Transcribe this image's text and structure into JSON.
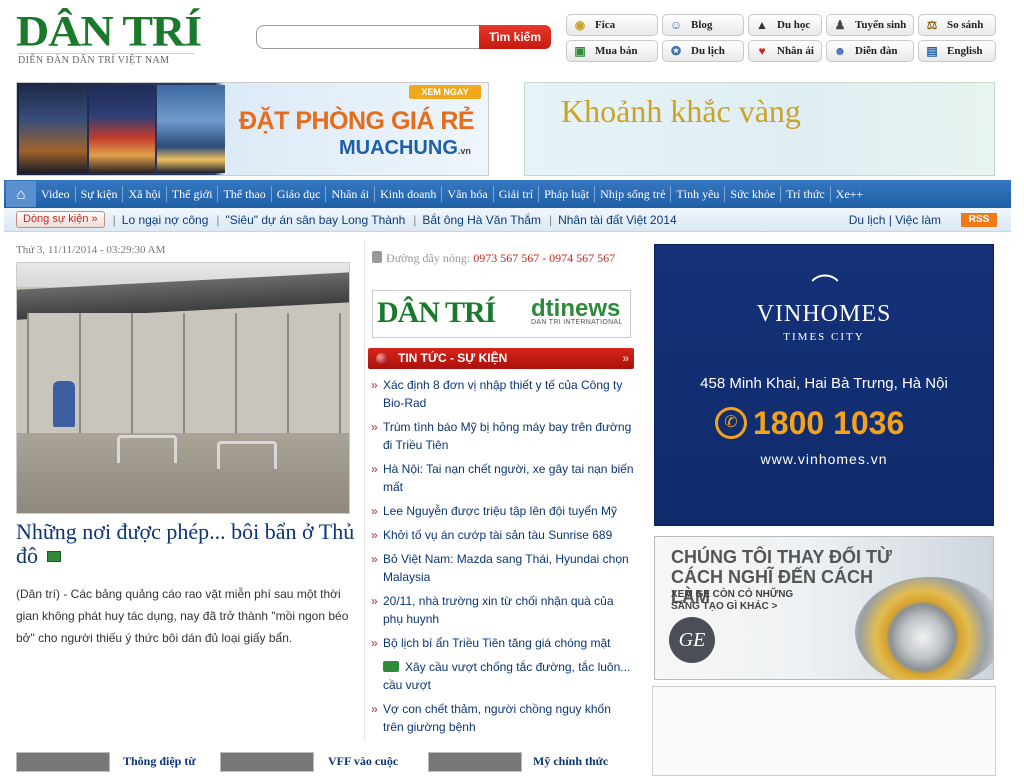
{
  "header": {
    "logo": "DÂN TRÍ",
    "tagline": "DIỄN ĐÀN DÂN TRÍ VIỆT NAM",
    "search": {
      "placeholder": "",
      "button": "Tìm kiếm"
    },
    "quick_links": [
      {
        "label": "Fica",
        "icon": "coins-icon"
      },
      {
        "label": "Blog",
        "icon": "users-icon"
      },
      {
        "label": "Du học",
        "icon": "graduation-cap-icon"
      },
      {
        "label": "Tuyển sinh",
        "icon": "student-icon"
      },
      {
        "label": "So sánh",
        "icon": "scales-icon"
      },
      {
        "label": "Mua bán",
        "icon": "shopping-icon"
      },
      {
        "label": "Du lịch",
        "icon": "compass-icon"
      },
      {
        "label": "Nhân ái",
        "icon": "heart-icon"
      },
      {
        "label": "Diễn đàn",
        "icon": "forum-icon"
      },
      {
        "label": "English",
        "icon": "book-icon"
      }
    ]
  },
  "banners": {
    "left": {
      "cta": "XEM NGAY",
      "headline": "ĐẶT PHÒNG GIÁ RẺ",
      "brand": "MUACHUNG",
      "brand_suffix": ".vn"
    },
    "right": {
      "headline": "Khoảnh khắc vàng"
    }
  },
  "nav": {
    "home_icon": "home-icon",
    "items": [
      "Video",
      "Sự kiện",
      "Xã hội",
      "Thế giới",
      "Thể thao",
      "Giáo dục",
      "Nhân ái",
      "Kinh doanh",
      "Văn hóa",
      "Giải trí",
      "Pháp luật",
      "Nhịp sống trẻ",
      "Tình yêu",
      "Sức khỏe",
      "Trí thức",
      "Xe++"
    ]
  },
  "subbar": {
    "label": "Dòng sự kiện »",
    "hot_topics": [
      "Lo ngại nợ công",
      "\"Siêu\" dự án sân bay Long Thành",
      "Bắt ông Hà Văn Thắm",
      "Nhân tài đất Việt 2014"
    ],
    "right_links": [
      "Du lịch",
      "Việc làm"
    ],
    "rss": "RSS"
  },
  "main": {
    "date": "Thứ 3, 11/11/2014 - 03:29:30 AM",
    "title": "Những nơi được phép... bôi bẩn ở Thủ đô",
    "summary": "(Dân trí) - Các bảng quảng cáo rao vặt miễn phí sau một thời gian không phát huy tác dụng, nay đã trở thành \"mồi ngon béo bở\" cho người thiếu ý thức bôi dán đủ loại giấy bẩn."
  },
  "thumbs": [
    {
      "text": "Thông điệp từ"
    },
    {
      "text": "VFF vào cuộc"
    },
    {
      "text": "Mỹ chính thức"
    }
  ],
  "middle": {
    "hotline_label": "Đường dây nóng:",
    "hotline_numbers": "0973 567 567 - 0974 567 567",
    "logo_dantri": "DÂN TRÍ",
    "logo_dti": "dtinews",
    "logo_dti_sub": "DAN TRI INTERNATIONAL",
    "section_title": "TIN TỨC - SỰ KIỆN",
    "news": [
      "Xác định 8 đơn vị nhập thiết y tế của Công ty Bio-Rad",
      "Trùm tình báo Mỹ bị hỏng máy bay trên đường đi Triều Tiên",
      "Hà Nội: Tai nạn chết người, xe gây tai nạn biến mất",
      "Lee Nguyễn được triệu tập lên đội tuyển Mỹ",
      "Khởi tố vụ án cướp tài sản tàu Sunrise 689",
      "Bỏ Việt Nam: Mazda sang Thái, Hyundai chọn Malaysia",
      "20/11, nhà trường xin từ chối nhận quà của phụ huynh",
      "Bộ lịch bí ẩn Triều Tiên tăng giá chóng mặt",
      "Xây cầu vượt chống tắc đường, tắc luôn... cầu vượt",
      "Vợ con chết thảm, người chồng nguy khốn trên giường bệnh"
    ]
  },
  "ads": {
    "vinhomes": {
      "brand": "VINHOMES",
      "sub": "TIMES CITY",
      "address": "458 Minh Khai, Hai Bà Trưng, Hà Nội",
      "phone": "1800 1036",
      "web": "www.vinhomes.vn"
    },
    "ge": {
      "headline": "CHÚNG TÔI THAY ĐỔI TỪ CÁCH NGHĨ ĐẾN CÁCH LÀM",
      "small1": "XEM GE CÒN CÓ NHỮNG",
      "small2": "SÁNG TẠO GÌ KHÁC >",
      "logo": "GE"
    }
  },
  "colors": {
    "brand_green": "#1a7a2c",
    "nav_blue": "#1f5fa6",
    "accent_red": "#c0291d",
    "link_blue": "#0b3577"
  }
}
